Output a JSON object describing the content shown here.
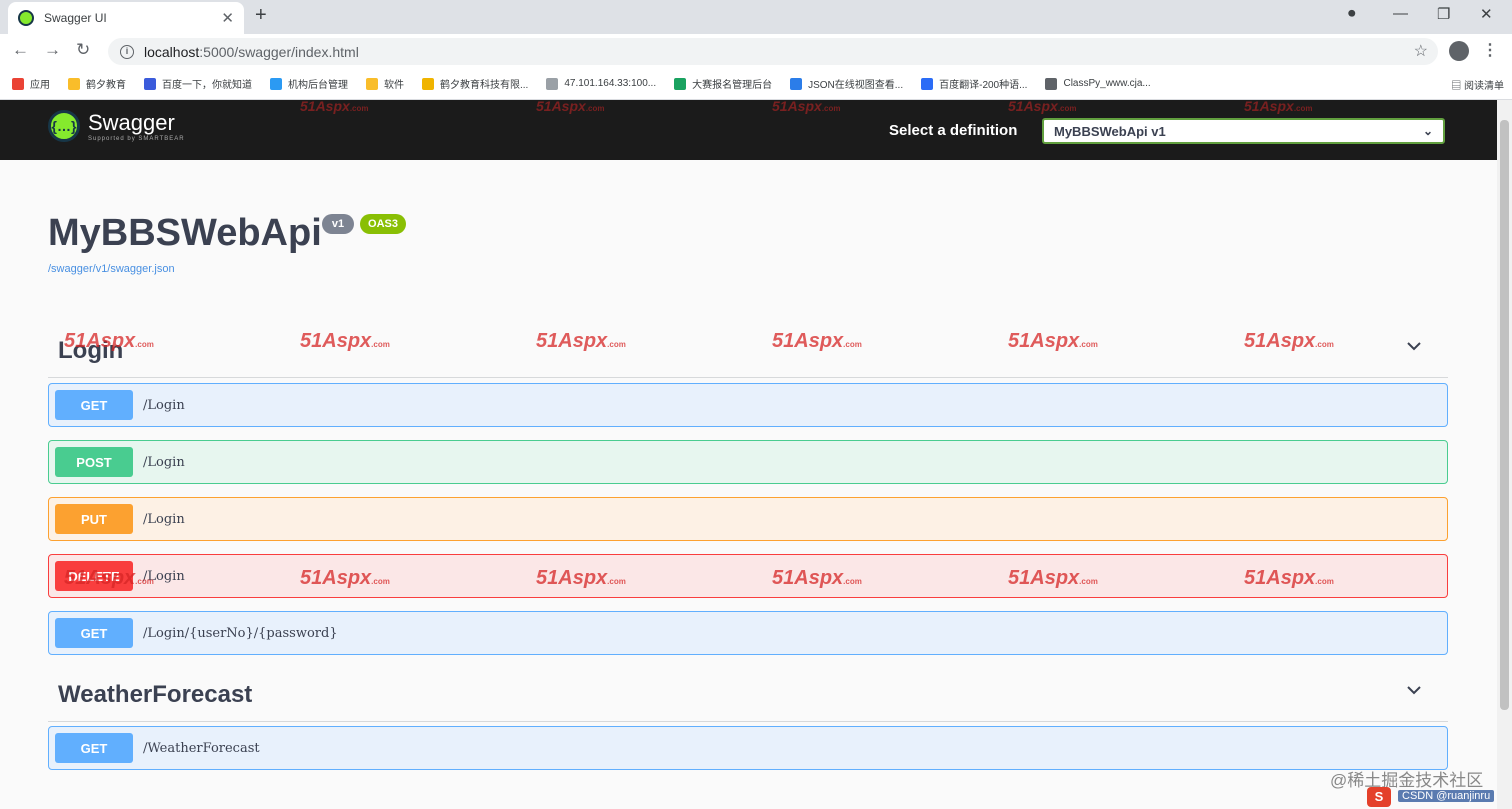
{
  "browser": {
    "tab_title": "Swagger UI",
    "url_host": "localhost",
    "url_path": ":5000/swagger/index.html",
    "bookmarks": [
      {
        "label": "应用",
        "color": "#ea4335"
      },
      {
        "label": "鹤夕教育",
        "color": "#f9bd2a"
      },
      {
        "label": "百度一下，你就知道",
        "color": "#3b5bdb"
      },
      {
        "label": "机构后台管理",
        "color": "#2b9af3"
      },
      {
        "label": "软件",
        "color": "#f9bd2a"
      },
      {
        "label": "鹤夕教育科技有限...",
        "color": "#f0b400"
      },
      {
        "label": "47.101.164.33:100...",
        "color": "#9aa0a6"
      },
      {
        "label": "大赛报名管理后台",
        "color": "#1aa260"
      },
      {
        "label": "JSON在线视图查看...",
        "color": "#2b7de9"
      },
      {
        "label": "百度翻译-200种语...",
        "color": "#2b6cf6"
      },
      {
        "label": "ClassPy_www.cja...",
        "color": "#5f6368"
      }
    ],
    "reading_list": "阅读清单"
  },
  "topbar": {
    "logo_name": "Swagger",
    "logo_sub": "Supported by SMARTBEAR",
    "definition_label": "Select a definition",
    "definition_value": "MyBBSWebApi v1"
  },
  "info": {
    "title": "MyBBSWebApi",
    "version": "v1",
    "oas": "OAS3",
    "spec_url": "/swagger/v1/swagger.json"
  },
  "tags": [
    {
      "name": "Login",
      "operations": [
        {
          "method": "GET",
          "path": "/Login"
        },
        {
          "method": "POST",
          "path": "/Login"
        },
        {
          "method": "PUT",
          "path": "/Login"
        },
        {
          "method": "DELETE",
          "path": "/Login"
        },
        {
          "method": "GET",
          "path": "/Login/{userNo}/{password}"
        }
      ]
    },
    {
      "name": "WeatherForecast",
      "operations": [
        {
          "method": "GET",
          "path": "/WeatherForecast"
        }
      ]
    }
  ],
  "watermark": {
    "main": "51Aspx",
    "suffix": ".com"
  },
  "corner": {
    "text": "@稀土掘金技术社区",
    "sub": "CSDN @ruanjinru",
    "logo": "S"
  },
  "colors": {
    "get": "#61affe",
    "post": "#49cc90",
    "put": "#fca130",
    "delete": "#f93e3e",
    "topbar": "#1b1b1b",
    "select_border": "#62a03f"
  }
}
